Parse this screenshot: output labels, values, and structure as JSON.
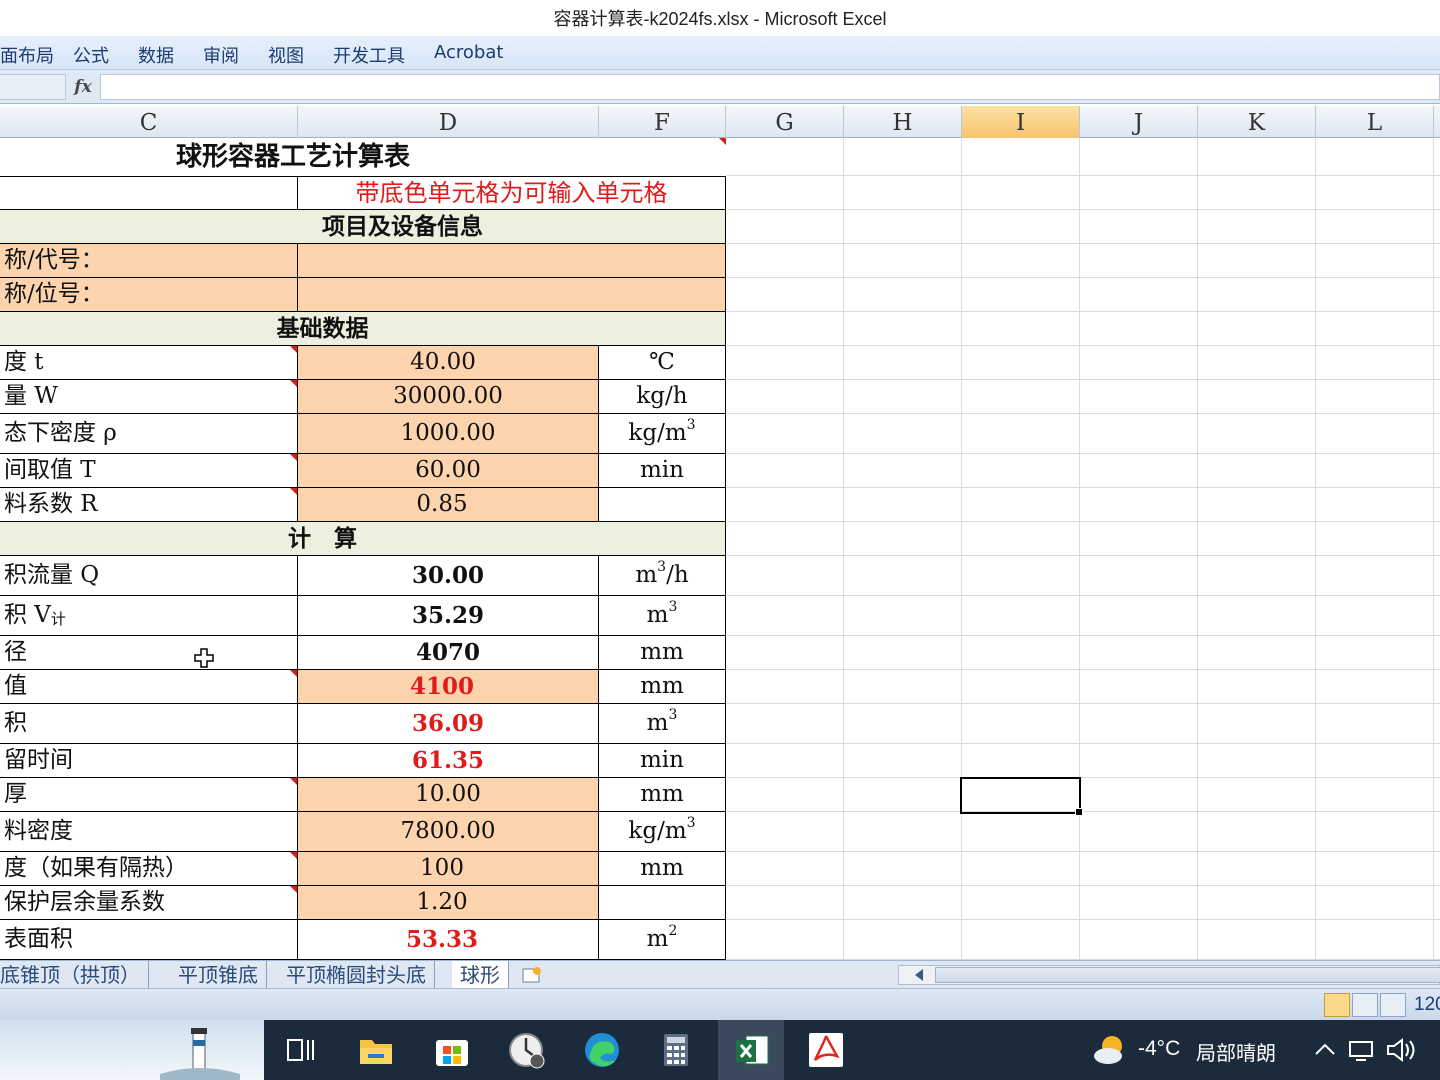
{
  "window": {
    "title": "容器计算表-k2024fs.xlsx - Microsoft Excel"
  },
  "ribbon": {
    "tabs": [
      "面布局",
      "公式",
      "数据",
      "审阅",
      "视图",
      "开发工具",
      "Acrobat"
    ]
  },
  "formula_bar": {
    "fx_label": "fx"
  },
  "columns": [
    "C",
    "D",
    "F",
    "G",
    "H",
    "I",
    "J",
    "K",
    "L"
  ],
  "active_column": "I",
  "sheet": {
    "title": "球形容器工艺计算表",
    "note": "带底色单元格为可输入单元格",
    "sections": {
      "project": "项目及设备信息",
      "basic": "基础数据",
      "calc": "计　算"
    },
    "project_rows": [
      {
        "label": "称/代号：",
        "value": ""
      },
      {
        "label": "称/位号：",
        "value": ""
      }
    ],
    "basic_rows": [
      {
        "label": "度 t",
        "value": "40.00",
        "unit": "℃"
      },
      {
        "label": "量 W",
        "value": "30000.00",
        "unit": "kg/h"
      },
      {
        "label": "态下密度 ρ",
        "value": "1000.00",
        "unit": "kg/m",
        "unit_sup": "3"
      },
      {
        "label": "间取值 T",
        "value": "60.00",
        "unit": "min"
      },
      {
        "label": "料系数 R",
        "value": "0.85",
        "unit": ""
      }
    ],
    "calc_rows": [
      {
        "label": "积流量 Q",
        "value": "30.00",
        "unit": "m",
        "unit_sup": "3",
        "unit_tail": "/h"
      },
      {
        "label": "积 V",
        "label_sub": "计",
        "value": "35.29",
        "unit": "m",
        "unit_sup": "3"
      },
      {
        "label": "径",
        "value": "4070",
        "unit": "mm"
      },
      {
        "label": "值",
        "value": "4100",
        "unit": "mm"
      },
      {
        "label": "积",
        "value": "36.09",
        "unit": "m",
        "unit_sup": "3"
      },
      {
        "label": "留时间",
        "value": "61.35",
        "unit": "min"
      },
      {
        "label": "厚",
        "value": "10.00",
        "unit": "mm"
      },
      {
        "label": "料密度",
        "value": "7800.00",
        "unit": "kg/m",
        "unit_sup": "3"
      },
      {
        "label": "度（如果有隔热）",
        "value": "100",
        "unit": "mm"
      },
      {
        "label": "保护层余量系数",
        "value": "1.20",
        "unit": ""
      },
      {
        "label": "表面积",
        "value": "53.33",
        "unit": "m",
        "unit_sup": "2"
      }
    ]
  },
  "sheet_tabs": [
    "底锥顶（拱顶）",
    "平顶锥底",
    "平顶椭圆封头底",
    "球形"
  ],
  "active_sheet_tab": "球形",
  "status": {
    "zoom": "120"
  },
  "taskbar": {
    "weather_temp": "-4°C",
    "weather_desc": "局部晴朗"
  },
  "colors": {
    "input_fill": "#fdd4ae",
    "section_fill": "#ebf1de",
    "note_red": "#e01b1b",
    "active_header": "#f6c46d"
  },
  "icons": [
    "fx-icon",
    "cursor-cross-icon",
    "new-sheet-icon",
    "task-view-icon",
    "file-explorer-icon",
    "store-icon",
    "clock-icon",
    "edge-icon",
    "calculator-icon",
    "excel-icon",
    "acrobat-icon",
    "weather-icon",
    "chevron-up-icon",
    "network-icon",
    "volume-icon"
  ]
}
